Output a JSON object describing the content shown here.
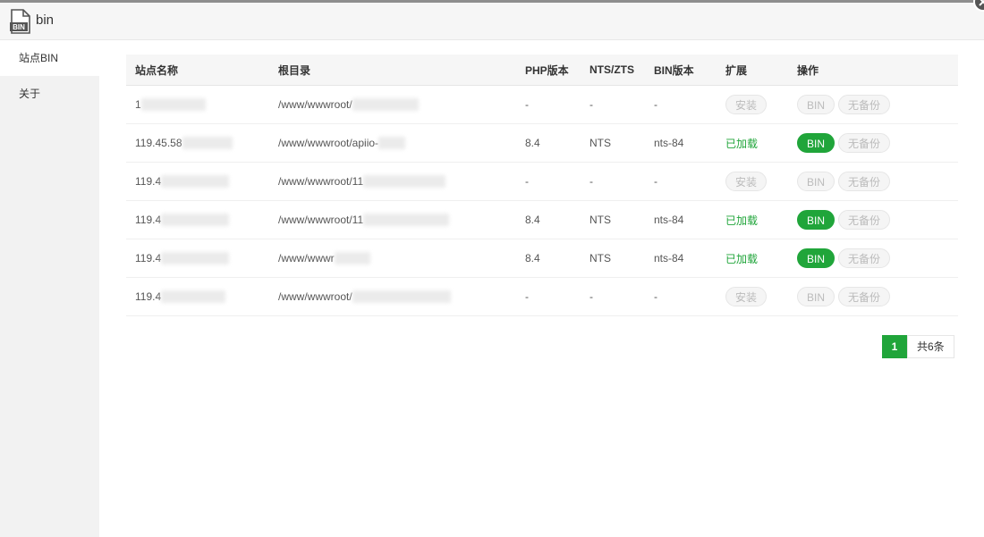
{
  "window": {
    "title": "bin",
    "icon_text": "BIN"
  },
  "sidebar": {
    "items": [
      {
        "label": "站点BIN"
      },
      {
        "label": "关于"
      }
    ]
  },
  "table": {
    "headers": [
      "站点名称",
      "根目录",
      "PHP版本",
      "NTS/ZTS",
      "BIN版本",
      "扩展",
      "操作"
    ],
    "rows": [
      {
        "name": "1",
        "path": "/www/wwwroot/",
        "php": "-",
        "nts": "-",
        "bin": "-",
        "ext": "安装",
        "loaded": false
      },
      {
        "name": "119.45.58",
        "path": "/www/wwwroot/apiio-",
        "php": "8.4",
        "nts": "NTS",
        "bin": "nts-84",
        "ext": "已加载",
        "loaded": true
      },
      {
        "name": "119.4",
        "path": "/www/wwwroot/11",
        "php": "-",
        "nts": "-",
        "bin": "-",
        "ext": "安装",
        "loaded": false
      },
      {
        "name": "119.4",
        "path": "/www/wwwroot/11",
        "php": "8.4",
        "nts": "NTS",
        "bin": "nts-84",
        "ext": "已加载",
        "loaded": true
      },
      {
        "name": "119.4",
        "path": "/www/wwwr",
        "php": "8.4",
        "nts": "NTS",
        "bin": "nts-84",
        "ext": "已加载",
        "loaded": true
      },
      {
        "name": "119.4",
        "path": "/www/wwwroot/",
        "php": "-",
        "nts": "-",
        "bin": "-",
        "ext": "安装",
        "loaded": false
      }
    ],
    "action_bin": "BIN",
    "action_backup": "无备份"
  },
  "pagination": {
    "current": "1",
    "total": "共6条"
  },
  "colors": {
    "accent": "#20a53a",
    "disabled_text": "#bbbbbb"
  }
}
